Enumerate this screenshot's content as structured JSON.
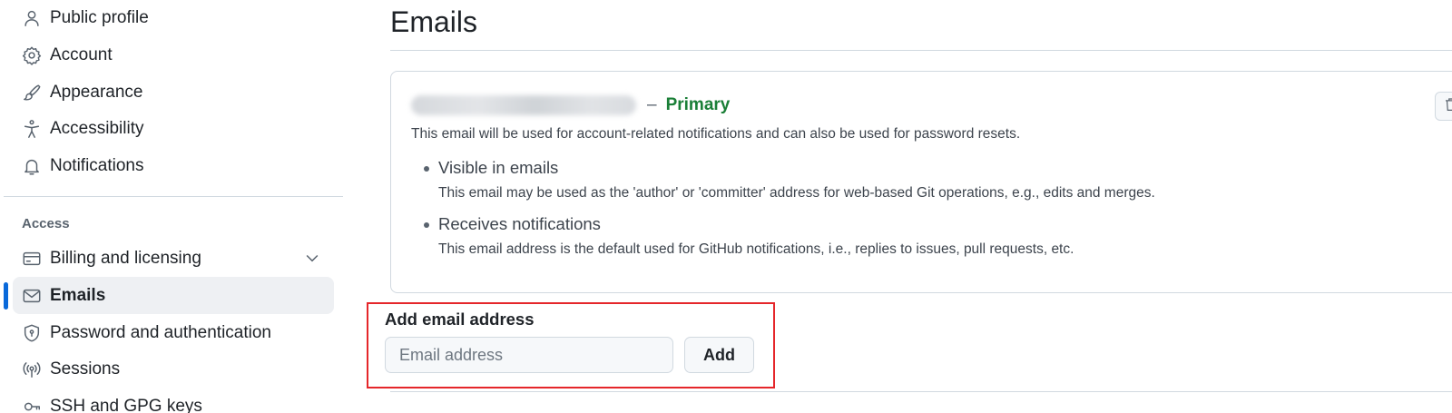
{
  "sidebar": {
    "items": [
      {
        "label": "Public profile",
        "icon": "person-icon"
      },
      {
        "label": "Account",
        "icon": "gear-icon"
      },
      {
        "label": "Appearance",
        "icon": "paintbrush-icon"
      },
      {
        "label": "Accessibility",
        "icon": "accessibility-icon"
      },
      {
        "label": "Notifications",
        "icon": "bell-icon"
      }
    ],
    "access_section": {
      "label": "Access",
      "items": [
        {
          "label": "Billing and licensing",
          "icon": "credit-card-icon"
        },
        {
          "label": "Emails",
          "icon": "mail-icon",
          "active": true
        },
        {
          "label": "Password and authentication",
          "icon": "shield-icon"
        },
        {
          "label": "Sessions",
          "icon": "broadcast-icon"
        },
        {
          "label": "SSH and GPG keys",
          "icon": "key-icon"
        }
      ]
    }
  },
  "main": {
    "title": "Emails",
    "email_card": {
      "dash": "–",
      "primary_label": "Primary",
      "description": "This email will be used for account-related notifications and can also be used for password resets.",
      "bullets": [
        {
          "title": "Visible in emails",
          "description": "This email may be used as the 'author' or 'committer' address for web-based Git operations, e.g., edits and merges."
        },
        {
          "title": "Receives notifications",
          "description": "This email address is the default used for GitHub notifications, i.e., replies to issues, pull requests, etc."
        }
      ]
    },
    "add_email": {
      "heading": "Add email address",
      "placeholder": "Email address",
      "button_label": "Add"
    }
  },
  "colors": {
    "accent": "#0969da",
    "primary_badge": "#1a7f37",
    "highlight_border": "#e5262a"
  }
}
